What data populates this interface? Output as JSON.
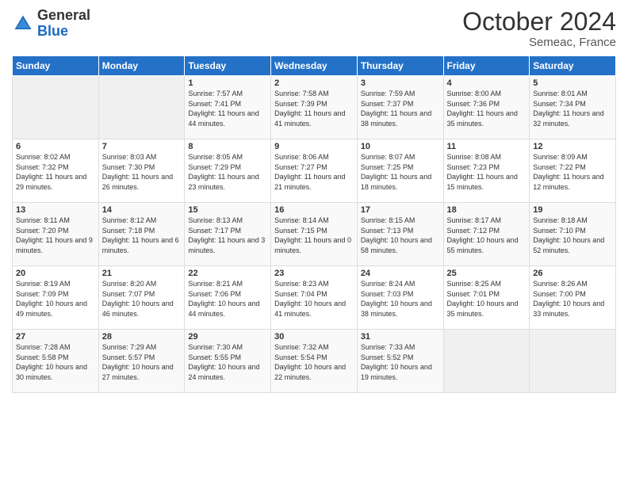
{
  "header": {
    "logo_general": "General",
    "logo_blue": "Blue",
    "month": "October 2024",
    "location": "Semeac, France"
  },
  "days_of_week": [
    "Sunday",
    "Monday",
    "Tuesday",
    "Wednesday",
    "Thursday",
    "Friday",
    "Saturday"
  ],
  "weeks": [
    [
      {
        "day": "",
        "info": ""
      },
      {
        "day": "",
        "info": ""
      },
      {
        "day": "1",
        "info": "Sunrise: 7:57 AM\nSunset: 7:41 PM\nDaylight: 11 hours and 44 minutes."
      },
      {
        "day": "2",
        "info": "Sunrise: 7:58 AM\nSunset: 7:39 PM\nDaylight: 11 hours and 41 minutes."
      },
      {
        "day": "3",
        "info": "Sunrise: 7:59 AM\nSunset: 7:37 PM\nDaylight: 11 hours and 38 minutes."
      },
      {
        "day": "4",
        "info": "Sunrise: 8:00 AM\nSunset: 7:36 PM\nDaylight: 11 hours and 35 minutes."
      },
      {
        "day": "5",
        "info": "Sunrise: 8:01 AM\nSunset: 7:34 PM\nDaylight: 11 hours and 32 minutes."
      }
    ],
    [
      {
        "day": "6",
        "info": "Sunrise: 8:02 AM\nSunset: 7:32 PM\nDaylight: 11 hours and 29 minutes."
      },
      {
        "day": "7",
        "info": "Sunrise: 8:03 AM\nSunset: 7:30 PM\nDaylight: 11 hours and 26 minutes."
      },
      {
        "day": "8",
        "info": "Sunrise: 8:05 AM\nSunset: 7:29 PM\nDaylight: 11 hours and 23 minutes."
      },
      {
        "day": "9",
        "info": "Sunrise: 8:06 AM\nSunset: 7:27 PM\nDaylight: 11 hours and 21 minutes."
      },
      {
        "day": "10",
        "info": "Sunrise: 8:07 AM\nSunset: 7:25 PM\nDaylight: 11 hours and 18 minutes."
      },
      {
        "day": "11",
        "info": "Sunrise: 8:08 AM\nSunset: 7:23 PM\nDaylight: 11 hours and 15 minutes."
      },
      {
        "day": "12",
        "info": "Sunrise: 8:09 AM\nSunset: 7:22 PM\nDaylight: 11 hours and 12 minutes."
      }
    ],
    [
      {
        "day": "13",
        "info": "Sunrise: 8:11 AM\nSunset: 7:20 PM\nDaylight: 11 hours and 9 minutes."
      },
      {
        "day": "14",
        "info": "Sunrise: 8:12 AM\nSunset: 7:18 PM\nDaylight: 11 hours and 6 minutes."
      },
      {
        "day": "15",
        "info": "Sunrise: 8:13 AM\nSunset: 7:17 PM\nDaylight: 11 hours and 3 minutes."
      },
      {
        "day": "16",
        "info": "Sunrise: 8:14 AM\nSunset: 7:15 PM\nDaylight: 11 hours and 0 minutes."
      },
      {
        "day": "17",
        "info": "Sunrise: 8:15 AM\nSunset: 7:13 PM\nDaylight: 10 hours and 58 minutes."
      },
      {
        "day": "18",
        "info": "Sunrise: 8:17 AM\nSunset: 7:12 PM\nDaylight: 10 hours and 55 minutes."
      },
      {
        "day": "19",
        "info": "Sunrise: 8:18 AM\nSunset: 7:10 PM\nDaylight: 10 hours and 52 minutes."
      }
    ],
    [
      {
        "day": "20",
        "info": "Sunrise: 8:19 AM\nSunset: 7:09 PM\nDaylight: 10 hours and 49 minutes."
      },
      {
        "day": "21",
        "info": "Sunrise: 8:20 AM\nSunset: 7:07 PM\nDaylight: 10 hours and 46 minutes."
      },
      {
        "day": "22",
        "info": "Sunrise: 8:21 AM\nSunset: 7:06 PM\nDaylight: 10 hours and 44 minutes."
      },
      {
        "day": "23",
        "info": "Sunrise: 8:23 AM\nSunset: 7:04 PM\nDaylight: 10 hours and 41 minutes."
      },
      {
        "day": "24",
        "info": "Sunrise: 8:24 AM\nSunset: 7:03 PM\nDaylight: 10 hours and 38 minutes."
      },
      {
        "day": "25",
        "info": "Sunrise: 8:25 AM\nSunset: 7:01 PM\nDaylight: 10 hours and 35 minutes."
      },
      {
        "day": "26",
        "info": "Sunrise: 8:26 AM\nSunset: 7:00 PM\nDaylight: 10 hours and 33 minutes."
      }
    ],
    [
      {
        "day": "27",
        "info": "Sunrise: 7:28 AM\nSunset: 5:58 PM\nDaylight: 10 hours and 30 minutes."
      },
      {
        "day": "28",
        "info": "Sunrise: 7:29 AM\nSunset: 5:57 PM\nDaylight: 10 hours and 27 minutes."
      },
      {
        "day": "29",
        "info": "Sunrise: 7:30 AM\nSunset: 5:55 PM\nDaylight: 10 hours and 24 minutes."
      },
      {
        "day": "30",
        "info": "Sunrise: 7:32 AM\nSunset: 5:54 PM\nDaylight: 10 hours and 22 minutes."
      },
      {
        "day": "31",
        "info": "Sunrise: 7:33 AM\nSunset: 5:52 PM\nDaylight: 10 hours and 19 minutes."
      },
      {
        "day": "",
        "info": ""
      },
      {
        "day": "",
        "info": ""
      }
    ]
  ]
}
